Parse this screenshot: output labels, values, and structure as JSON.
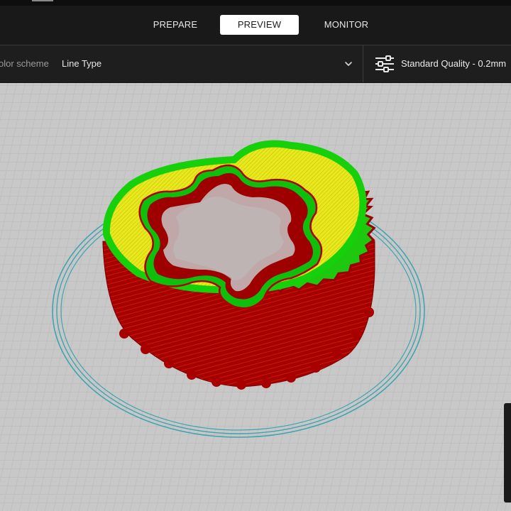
{
  "stages": {
    "prepare": "PREPARE",
    "preview": "PREVIEW",
    "monitor": "MONITOR",
    "active": "preview"
  },
  "toolbar": {
    "color_scheme_label": "olor scheme",
    "color_scheme_value": "Line Type",
    "quality": "Standard Quality - 0.2mm"
  },
  "icons": {
    "dropdown": "chevron-down-icon",
    "settings": "sliders-icon"
  },
  "line_type_colors": {
    "wall_outer": "#b60000",
    "wall_inner": "#19d60b",
    "infill_top": "#e6e61c",
    "skirt": "#3fa3b0"
  },
  "colors": {
    "chrome_bg": "#191919",
    "buildplate": "#c8c8c8"
  }
}
